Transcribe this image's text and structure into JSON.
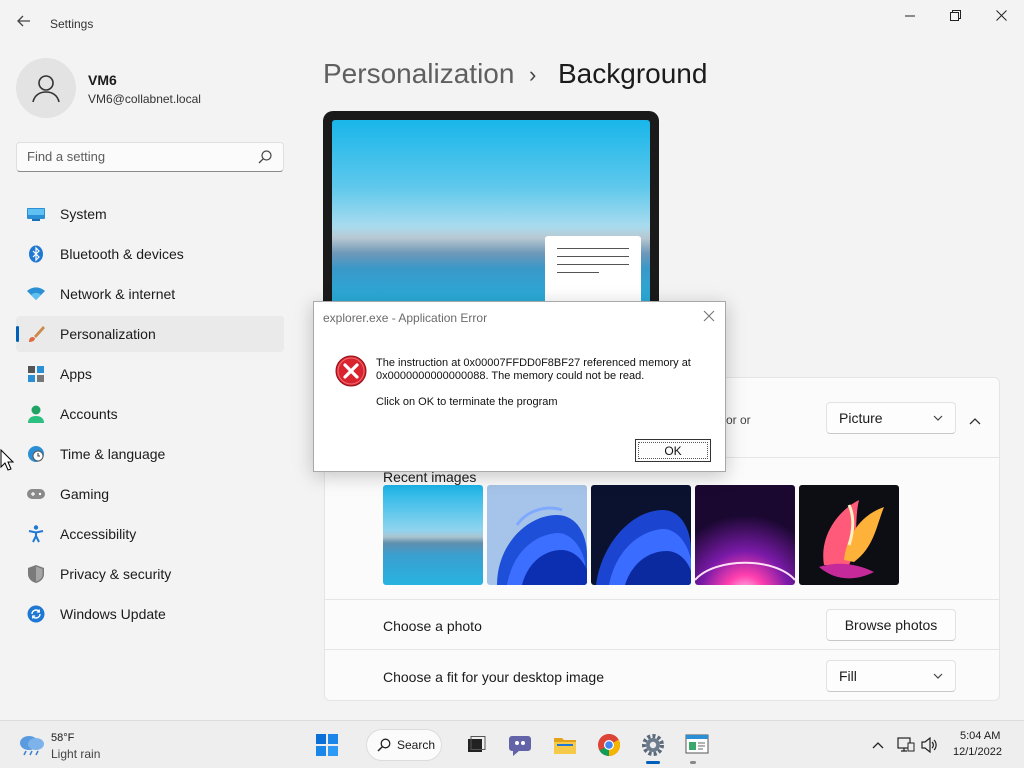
{
  "window": {
    "title": "Settings"
  },
  "profile": {
    "name": "VM6",
    "email": "VM6@collabnet.local"
  },
  "search": {
    "placeholder": "Find a setting"
  },
  "sidebar": {
    "items": [
      {
        "label": "System",
        "icon": "monitor-icon"
      },
      {
        "label": "Bluetooth & devices",
        "icon": "bluetooth-icon"
      },
      {
        "label": "Network & internet",
        "icon": "wifi-icon"
      },
      {
        "label": "Personalization",
        "icon": "paintbrush-icon",
        "active": true
      },
      {
        "label": "Apps",
        "icon": "apps-icon"
      },
      {
        "label": "Accounts",
        "icon": "person-icon"
      },
      {
        "label": "Time & language",
        "icon": "globe-clock-icon"
      },
      {
        "label": "Gaming",
        "icon": "gamepad-icon"
      },
      {
        "label": "Accessibility",
        "icon": "accessibility-icon"
      },
      {
        "label": "Privacy & security",
        "icon": "shield-icon"
      },
      {
        "label": "Windows Update",
        "icon": "update-icon"
      }
    ]
  },
  "header": {
    "parent": "Personalization",
    "separator": "›",
    "current": "Background"
  },
  "background": {
    "fragment": "or or",
    "type_value": "Picture",
    "recent_images_label": "Recent images",
    "choose_photo_label": "Choose a photo",
    "browse_button": "Browse photos",
    "fit_label": "Choose a fit for your desktop image",
    "fit_value": "Fill"
  },
  "dialog": {
    "title": "explorer.exe - Application Error",
    "message": "The instruction at 0x00007FFDD0F8BF27 referenced memory at 0x0000000000000088. The memory could not be read.",
    "sub": "Click on OK to terminate the program",
    "ok_label": "OK"
  },
  "taskbar": {
    "weather_temp": "58°F",
    "weather_desc": "Light rain",
    "search_label": "Search",
    "time": "5:04 AM",
    "date": "12/1/2022"
  },
  "colors": {
    "accent": "#005fb8",
    "error": "#d9232e"
  }
}
